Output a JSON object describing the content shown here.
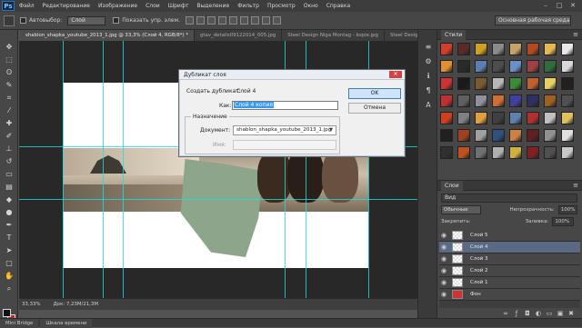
{
  "app": {
    "logo": "Ps"
  },
  "menu": [
    "Файл",
    "Редактирование",
    "Изображение",
    "Слои",
    "Шрифт",
    "Выделение",
    "Фильтр",
    "Просмотр",
    "Окно",
    "Справка"
  ],
  "options": {
    "autoselect_label": "Автовыбор:",
    "autoselect_value": "Слой",
    "show_controls_label": "Показать упр. элем.",
    "workspace": "Основная рабочая среда"
  },
  "tabs": [
    {
      "label": "shablon_shapka_youtube_2013_1.jpg @ 33,3% (Слой 4, RGB/8*) *"
    },
    {
      "label": "gtav_details09122014_005.jpg"
    },
    {
      "label": "Steel Design Niga Montag - kopie.jpg"
    },
    {
      "label": "Steel Design Niga Mont"
    }
  ],
  "statusbar": {
    "zoom": "33,33%",
    "doc": "Док: 7,23M/21,3M"
  },
  "bottom_tabs": [
    "Mini Bridge",
    "Шкала времени"
  ],
  "styles_panel": {
    "title": "Стили"
  },
  "layers_panel": {
    "title": "Слои",
    "kind": "Вид",
    "blend": "Обычные",
    "opacity_label": "Непрозрачность:",
    "opacity_value": "100%",
    "lock_label": "Закрепить:",
    "fill_label": "Заливка:",
    "fill_value": "100%",
    "layers": [
      {
        "name": "Слой 5",
        "selected": false
      },
      {
        "name": "Слой 4",
        "selected": true
      },
      {
        "name": "Слой 3",
        "selected": false
      },
      {
        "name": "Слой 2",
        "selected": false
      },
      {
        "name": "Слой 1",
        "selected": false
      },
      {
        "name": "Фон",
        "selected": false
      }
    ]
  },
  "dialog": {
    "title": "Дубликат слоя",
    "duplicate_label": "Создать дубликат:",
    "duplicate_value": "Слой 4",
    "as_label": "Как:",
    "as_value": "Слой 4 копия",
    "group_label": "Назначение",
    "document_label": "Документ:",
    "document_value": "shablon_shapka_youtube_2013_1.jpg",
    "name_label": "Имя:",
    "ok": "OK",
    "cancel": "Отмена"
  },
  "style_swatch_colors": [
    "#d23d2d",
    "#5a2a2a",
    "#d0a020",
    "#8a8a8a",
    "#c7a36a",
    "#b24a20",
    "#e6b850",
    "#e8e8e8",
    "#e09030",
    "#2a2a2a",
    "#5b7fb0",
    "#4d4d4d",
    "#6b8fc8",
    "#a04040",
    "#2f6d3a",
    "#d9d9d9",
    "#cc3333",
    "#1a1a1a",
    "#7a5a30",
    "#b8b8b8",
    "#3a8a3a",
    "#c06030",
    "#e8d060",
    "#202020",
    "#c03030",
    "#606060",
    "#9090a0",
    "#d07030",
    "#4040a0",
    "#303060",
    "#a06020",
    "#505050",
    "#d04020",
    "#808080",
    "#e0a040",
    "#404040",
    "#6080b0",
    "#b03030",
    "#c0c0c0",
    "#e0c060",
    "#202020",
    "#a04020",
    "#a0a0a0",
    "#305080",
    "#d08040",
    "#602020",
    "#909090",
    "#e0e0e0",
    "#303030",
    "#c05020",
    "#707070",
    "#b0b0b0",
    "#d0b040",
    "#802020",
    "#505050",
    "#c8c8c8"
  ]
}
